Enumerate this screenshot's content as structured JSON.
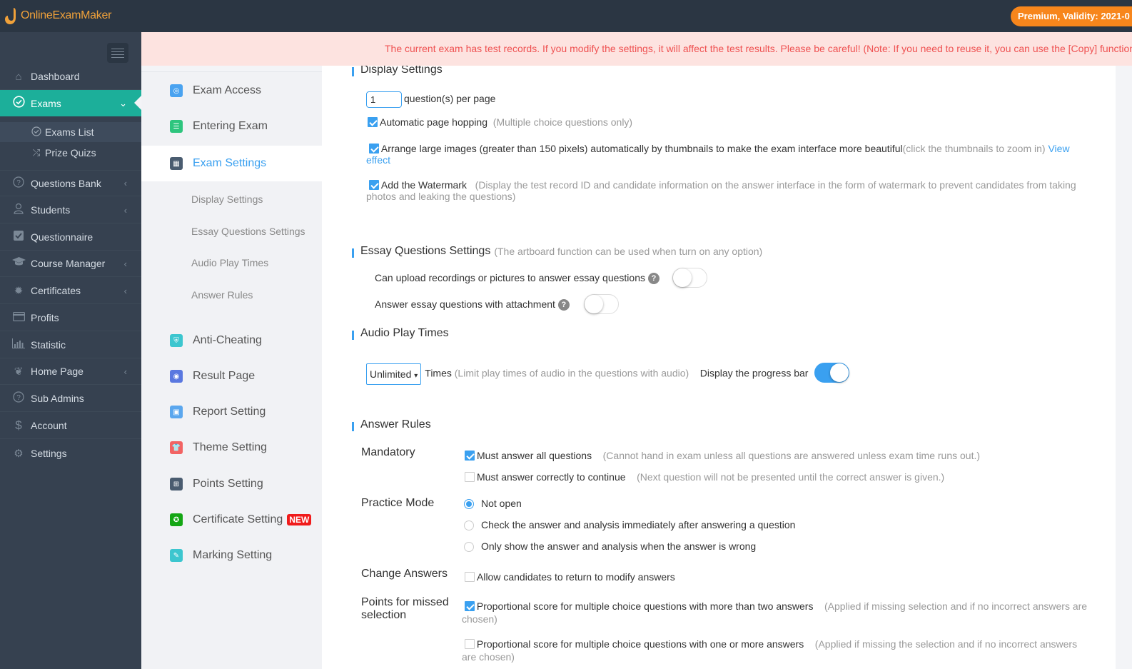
{
  "app": {
    "logo": "OnlineExamMaker",
    "premium_badge": "Premium, Validity: 2021-0"
  },
  "sidebar": {
    "items": [
      {
        "label": "Dashboard",
        "icon": "home-icon"
      },
      {
        "label": "Exams",
        "icon": "check-circle-icon",
        "active": true
      },
      {
        "label": "Questions Bank",
        "icon": "question-circle-icon"
      },
      {
        "label": "Students",
        "icon": "user-icon"
      },
      {
        "label": "Questionnaire",
        "icon": "checkbox-icon"
      },
      {
        "label": "Course Manager",
        "icon": "graduation-cap-icon"
      },
      {
        "label": "Certificates",
        "icon": "certificate-icon"
      },
      {
        "label": "Profits",
        "icon": "credit-card-icon"
      },
      {
        "label": "Statistic",
        "icon": "bar-chart-icon"
      },
      {
        "label": "Home Page",
        "icon": "leaf-icon"
      },
      {
        "label": "Sub Admins",
        "icon": "question-circle-icon"
      },
      {
        "label": "Account",
        "icon": "dollar-icon"
      },
      {
        "label": "Settings",
        "icon": "gear-icon"
      }
    ],
    "exam_sub": [
      {
        "label": "Exams List",
        "icon": "check-circle-icon"
      },
      {
        "label": "Prize Quizs",
        "icon": "shuffle-icon"
      }
    ]
  },
  "banner": "The current exam has test records. If you modify the settings, it will affect the test results. Please be careful! (Note: If you need to reuse it, you can use the [Copy] function",
  "subnav": {
    "items": [
      {
        "label": "Exam Access",
        "color": "#4aa3f0"
      },
      {
        "label": "Entering Exam",
        "color": "#2ec57e"
      },
      {
        "label": "Exam Settings",
        "color": "#4a5c70"
      },
      {
        "label": "Anti-Cheating",
        "color": "#3cc6cf"
      },
      {
        "label": "Result Page",
        "color": "#5a78e0"
      },
      {
        "label": "Report Setting",
        "color": "#5ba7ee"
      },
      {
        "label": "Theme Setting",
        "color": "#f26363"
      },
      {
        "label": "Points Setting",
        "color": "#4a5c70"
      },
      {
        "label": "Certificate Setting",
        "color": "#14a614"
      },
      {
        "label": "Marking Setting",
        "color": "#3cc6cf"
      }
    ],
    "children": [
      "Display Settings",
      "Essay Questions Settings",
      "Audio Play Times",
      "Answer Rules"
    ],
    "new_badge": "NEW"
  },
  "display": {
    "title": "Display Settings",
    "per_page_value": "1",
    "per_page_label": "question(s) per page",
    "auto_hop": {
      "label": "Automatic page hopping",
      "hint": "(Multiple choice questions only)",
      "checked": true
    },
    "thumbnails": {
      "label": "Arrange large images (greater than 150 pixels) automatically by thumbnails to make the exam interface more beautiful",
      "hint": "(click the thumbnails to zoom in)",
      "link": "View effect",
      "checked": true
    },
    "watermark": {
      "label": "Add the Watermark",
      "hint": "(Display the test record ID and candidate information on the answer interface in the form of watermark to prevent candidates from taking photos and leaking the questions)",
      "checked": true
    }
  },
  "essay": {
    "title": "Essay Questions Settings",
    "hint": "(The artboard function can be used when turn on any option)",
    "upload": {
      "label": "Can upload recordings or pictures to answer essay questions",
      "on": false
    },
    "attachment": {
      "label": "Answer essay questions with attachment",
      "on": false
    },
    "help": "?"
  },
  "audio": {
    "title": "Audio Play Times",
    "select_value": "Unlimited",
    "times_label": "Times",
    "hint": "(Limit play times of audio in the questions with audio)",
    "progress_label": "Display the progress bar",
    "progress_on": true
  },
  "rules": {
    "title": "Answer Rules",
    "mandatory": {
      "label": "Mandatory",
      "options": [
        {
          "label": "Must answer all questions",
          "hint": "(Cannot hand in exam unless all questions are answered unless exam time runs out.)",
          "checked": true
        },
        {
          "label": "Must answer correctly to continue",
          "hint": "(Next question will not be presented until the correct answer is given.)",
          "checked": false
        }
      ]
    },
    "practice": {
      "label": "Practice Mode",
      "options": [
        {
          "label": "Not open",
          "selected": true
        },
        {
          "label": "Check the answer and analysis immediately after answering a question",
          "selected": false
        },
        {
          "label": "Only show the answer and analysis when the answer is wrong",
          "selected": false
        }
      ]
    },
    "change": {
      "label": "Change Answers",
      "option": "Allow candidates to return to modify answers",
      "checked": false
    },
    "missed": {
      "label": "Points for missed selection",
      "options": [
        {
          "label": "Proportional score for multiple choice questions with more than two answers",
          "hint": "(Applied if missing selection and if no incorrect answers are chosen)",
          "checked": true
        },
        {
          "label": "Proportional score for multiple choice questions with one or more answers",
          "hint": "(Applied if missing the selection and if no incorrect answers are chosen)",
          "checked": false
        }
      ]
    }
  }
}
